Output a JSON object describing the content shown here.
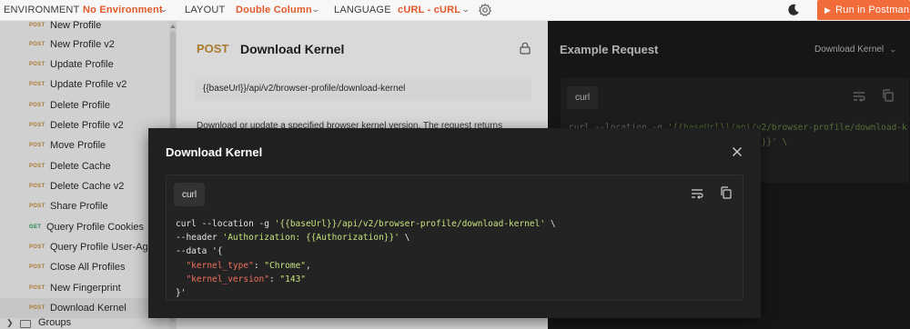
{
  "topbar": {
    "environment_label": "ENVIRONMENT",
    "environment_value": "No Environment",
    "layout_label": "LAYOUT",
    "layout_value": "Double Column",
    "language_label": "LANGUAGE",
    "language_value": "cURL - cURL",
    "run_button": "Run in Postman"
  },
  "sidebar": {
    "items": [
      {
        "method": "POST",
        "name": "New Profile"
      },
      {
        "method": "POST",
        "name": "New Profile v2"
      },
      {
        "method": "POST",
        "name": "Update Profile"
      },
      {
        "method": "POST",
        "name": "Update Profile v2"
      },
      {
        "method": "POST",
        "name": "Delete Profile"
      },
      {
        "method": "POST",
        "name": "Delete Profile v2"
      },
      {
        "method": "POST",
        "name": "Move Profile"
      },
      {
        "method": "POST",
        "name": "Delete Cache"
      },
      {
        "method": "POST",
        "name": "Delete Cache v2"
      },
      {
        "method": "POST",
        "name": "Share Profile"
      },
      {
        "method": "GET",
        "name": "Query Profile Cookies"
      },
      {
        "method": "POST",
        "name": "Query Profile User-Agent"
      },
      {
        "method": "POST",
        "name": "Close All Profiles"
      },
      {
        "method": "POST",
        "name": "New Fingerprint"
      },
      {
        "method": "POST",
        "name": "Download Kernel"
      }
    ],
    "groups_label": "Groups"
  },
  "main": {
    "method": "POST",
    "title": "Download Kernel",
    "url": "{{baseUrl}}/api/v2/browser-profile/download-kernel",
    "description": "Download or update a specified browser kernel version. The request returns"
  },
  "example": {
    "title": "Example Request",
    "select_value": "Download Kernel",
    "lang": "curl",
    "code_line1_prefix": "curl --location -g ",
    "code_line1_str": "'{{baseUrl}}/api/v2/browser-profile/download-k",
    "code_line2_str": "ion}}' \\"
  },
  "modal": {
    "title": "Download Kernel",
    "lang": "curl",
    "code": {
      "l1_prefix": "curl --location -g ",
      "l1_str": "'{{baseUrl}}/api/v2/browser-profile/download-kernel'",
      "l1_suffix": " \\",
      "l2_prefix": "--header ",
      "l2_str": "'Authorization: {{Authorization}}'",
      "l2_suffix": " \\",
      "l3": "--data '{",
      "l4_key": "\"kernel_type\"",
      "l4_sep": ": ",
      "l4_val": "\"Chrome\"",
      "l4_end": ",",
      "l5_key": "\"kernel_version\"",
      "l5_sep": ": ",
      "l5_val": "\"143\"",
      "l6": "}'"
    }
  },
  "colors": {
    "accent": "#e05a2b",
    "run_button": "#f26b3a",
    "post_method": "#c7913a",
    "get_method": "#2e9e5b",
    "code_string": "#c6e27e",
    "code_key": "#f0705a"
  }
}
